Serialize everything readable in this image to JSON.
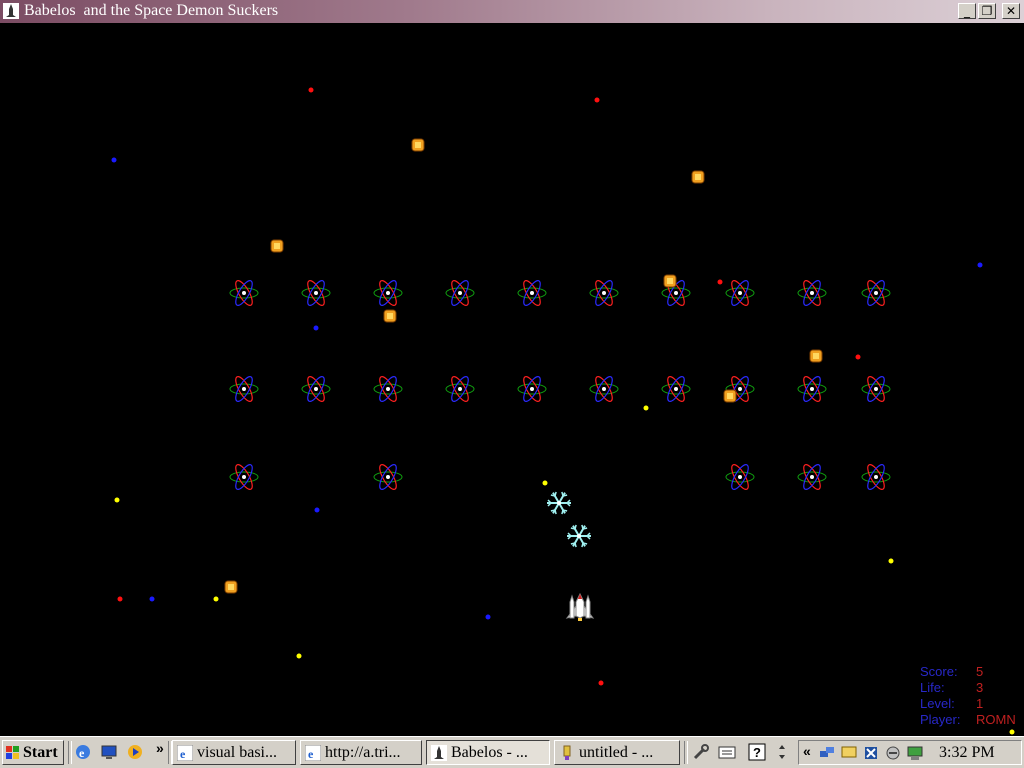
{
  "window": {
    "title": "Babelos  and the Space Demon Suckers",
    "minimize": "_",
    "restore": "❐",
    "close": "✕"
  },
  "hud": {
    "score_label": "Score:",
    "score": "5",
    "life_label": "Life:",
    "life": "3",
    "level_label": "Level:",
    "level": "1",
    "player_label": "Player:",
    "player": "ROMN"
  },
  "colors": {
    "enemy_orbit_red": "#ff2020",
    "enemy_orbit_blue": "#2a2aff",
    "enemy_orbit_green": "#10a010",
    "star_red": "#ff1010",
    "star_blue": "#1a1aff",
    "star_yellow": "#ffff00",
    "coin": "#f0a020",
    "snowflake": "#a0f0f0"
  },
  "taskbar": {
    "start_label": "Start",
    "quicklaunch_overflow": "»",
    "tasks": [
      {
        "label": "visual basi...",
        "icon": "ie-icon"
      },
      {
        "label": "http://a.tri...",
        "icon": "ie-icon"
      },
      {
        "label": "Babelos - ...",
        "icon": "game-icon"
      },
      {
        "label": "untitled - ...",
        "icon": "paint-icon"
      }
    ],
    "tray_overflow": "«",
    "clock": "3:32 PM"
  }
}
